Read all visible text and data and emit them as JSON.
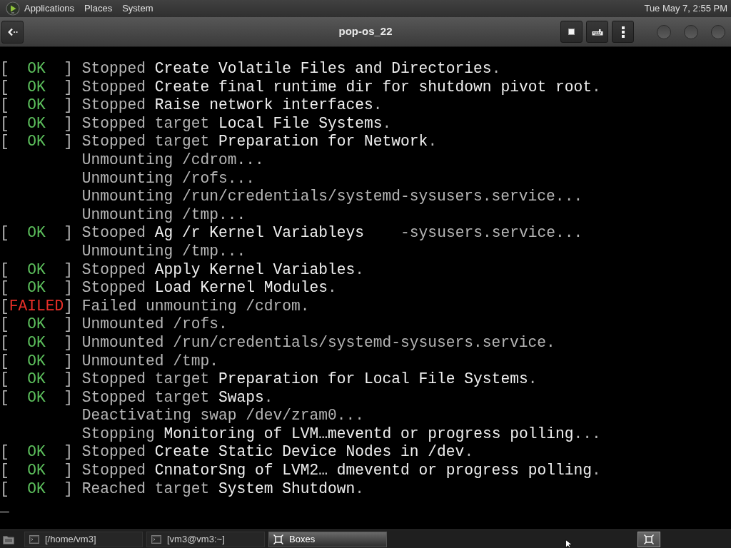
{
  "top_panel": {
    "menus": [
      "Applications",
      "Places",
      "System"
    ],
    "clock": "Tue May 7, 2:55 PM"
  },
  "window": {
    "title": "pop-os_22"
  },
  "console": {
    "lines": [
      {
        "kind": "ok",
        "status": [
          "[",
          "OK",
          "]"
        ],
        "lead": "Stopped",
        "name": "Create Volatile Files and Directories",
        "tail": "."
      },
      {
        "kind": "ok",
        "status": [
          "[",
          "OK",
          "]"
        ],
        "lead": "Stopped",
        "name": "Create final runtime dir for shutdown pivot root",
        "tail": "."
      },
      {
        "kind": "ok",
        "status": [
          "[",
          "OK",
          "]"
        ],
        "lead": "Stopped",
        "name": "Raise network interfaces",
        "tail": "."
      },
      {
        "kind": "ok",
        "status": [
          "[",
          "OK",
          "]"
        ],
        "lead": "Stopped target",
        "name": "Local File Systems",
        "tail": "."
      },
      {
        "kind": "ok",
        "status": [
          "[",
          "OK",
          "]"
        ],
        "lead": "Stopped target",
        "name": "Preparation for Network",
        "tail": "."
      },
      {
        "kind": "info",
        "lead": "Unmounting /cdrom..."
      },
      {
        "kind": "info",
        "lead": "Unmounting /rofs..."
      },
      {
        "kind": "info",
        "lead": "Unmounting /run/credentials/systemd-sysusers.service..."
      },
      {
        "kind": "info",
        "lead": "Unmounting /tmp..."
      },
      {
        "kind": "ok",
        "status": [
          "[",
          "OK",
          "]"
        ],
        "lead": "Stooped",
        "name": "Ag /r Kernel Variableys",
        "tail": "    -sysusers.service..."
      },
      {
        "kind": "info",
        "lead": "Unmounting /tmp..."
      },
      {
        "kind": "ok",
        "status": [
          "[",
          "OK",
          "]"
        ],
        "lead": "Stopped",
        "name": "Apply Kernel Variables",
        "tail": "."
      },
      {
        "kind": "ok",
        "status": [
          "[",
          "OK",
          "]"
        ],
        "lead": "Stopped",
        "name": "Load Kernel Modules",
        "tail": "."
      },
      {
        "kind": "failed",
        "status": [
          "[",
          "FAILED",
          "]"
        ],
        "lead": "Failed unmounting /cdrom."
      },
      {
        "kind": "ok",
        "status": [
          "[",
          "OK",
          "]"
        ],
        "lead": "Unmounted /rofs."
      },
      {
        "kind": "ok",
        "status": [
          "[",
          "OK",
          "]"
        ],
        "lead": "Unmounted /run/credentials/systemd-sysusers.service."
      },
      {
        "kind": "ok",
        "status": [
          "[",
          "OK",
          "]"
        ],
        "lead": "Unmounted /tmp."
      },
      {
        "kind": "ok",
        "status": [
          "[",
          "OK",
          "]"
        ],
        "lead": "Stopped target",
        "name": "Preparation for Local File Systems",
        "tail": "."
      },
      {
        "kind": "ok",
        "status": [
          "[",
          "OK",
          "]"
        ],
        "lead": "Stopped target",
        "name": "Swaps",
        "tail": "."
      },
      {
        "kind": "info",
        "lead": "Deactivating swap /dev/zram0..."
      },
      {
        "kind": "info",
        "lead": "Stopping",
        "name": "Monitoring of LVM…meventd or progress polling",
        "tail": "..."
      },
      {
        "kind": "ok",
        "status": [
          "[",
          "OK",
          "]"
        ],
        "lead": "Stopped",
        "name": "Create Static Device Nodes in /dev",
        "tail": "."
      },
      {
        "kind": "ok",
        "status": [
          "[",
          "OK",
          "]"
        ],
        "lead": "Stopped",
        "name": "CnnatorSng of LVM2… dmeventd or progress polling",
        "tail": "."
      },
      {
        "kind": "ok",
        "status": [
          "[",
          "OK",
          "]"
        ],
        "lead": "Reached target",
        "name": "System Shutdown",
        "tail": "."
      }
    ],
    "cursor": "_"
  },
  "taskbar": {
    "items": [
      {
        "kind": "terminal",
        "label": "[/home/vm3]",
        "selected": false
      },
      {
        "kind": "terminal",
        "label": "[vm3@vm3:~]",
        "selected": false
      },
      {
        "kind": "app",
        "label": "Boxes",
        "selected": true
      }
    ]
  }
}
